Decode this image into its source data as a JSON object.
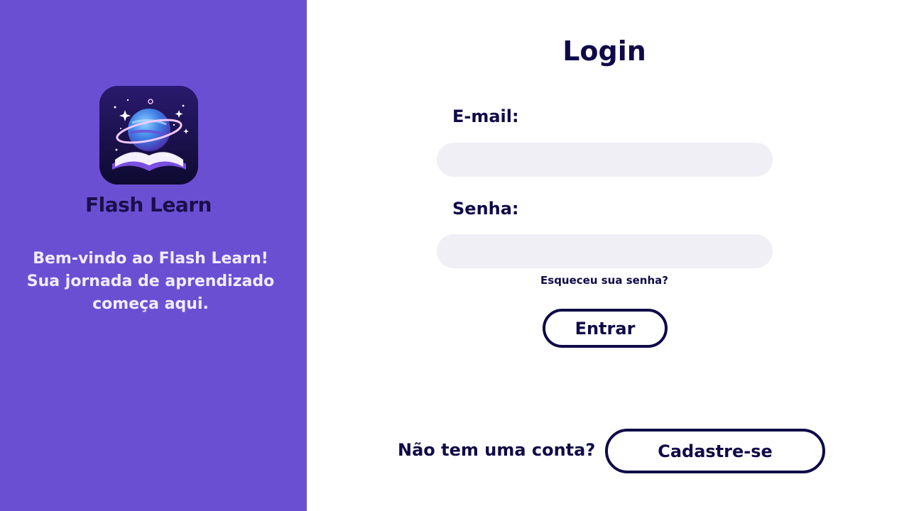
{
  "brand": {
    "name": "Flash Learn",
    "logo_icon": "planet-book-icon",
    "panel_color": "#6b4fd3"
  },
  "welcome": {
    "line1": "Bem-vindo ao Flash Learn!",
    "line2": "Sua jornada de aprendizado",
    "line3": "começa aqui."
  },
  "login": {
    "title": "Login",
    "email_label": "E-mail:",
    "email_value": "",
    "email_placeholder": "",
    "password_label": "Senha:",
    "password_value": "",
    "password_placeholder": "",
    "forgot_password": "Esqueceu sua senha?",
    "submit_label": "Entrar"
  },
  "signup": {
    "prompt": "Não tem uma conta?",
    "button_label": "Cadastre-se"
  },
  "colors": {
    "primary_dark": "#0f0a47",
    "input_bg": "#efeff5",
    "welcome_text": "#f1ecff"
  }
}
